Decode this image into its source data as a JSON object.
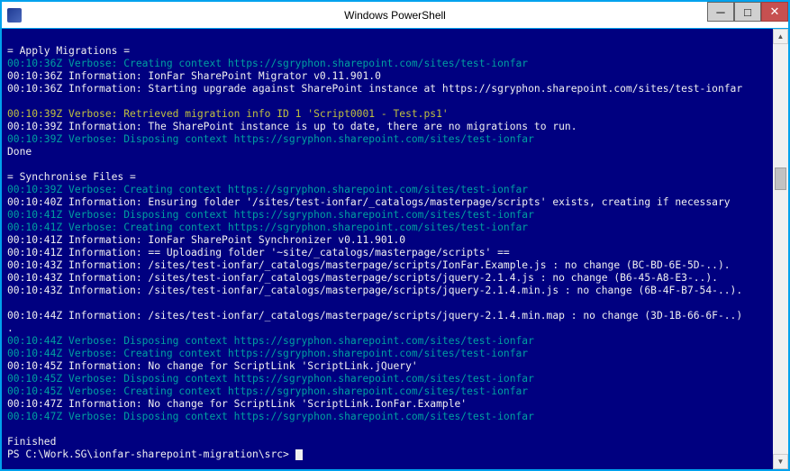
{
  "window": {
    "title": "Windows PowerShell"
  },
  "buttons": {
    "min": "─",
    "max": "□",
    "close": "✕"
  },
  "scrollbar": {
    "up": "▲",
    "down": "▼"
  },
  "colors": {
    "bg": "#000080",
    "accent": "#00a2ed",
    "cyan": "#00a0a0",
    "yellow": "#c0c040",
    "white": "#f0f0f0"
  },
  "prompt": "PS C:\\Work.SG\\ionfar-sharepoint-migration\\src> ",
  "lines": [
    {
      "c": "white",
      "t": ""
    },
    {
      "c": "white",
      "t": "= Apply Migrations ="
    },
    {
      "c": "cyan",
      "t": "00:10:36Z Verbose: Creating context https://sgryphon.sharepoint.com/sites/test-ionfar"
    },
    {
      "c": "white",
      "t": "00:10:36Z Information: IonFar SharePoint Migrator v0.11.901.0"
    },
    {
      "c": "white",
      "t": "00:10:36Z Information: Starting upgrade against SharePoint instance at https://sgryphon.sharepoint.com/sites/test-ionfar"
    },
    {
      "c": "white",
      "t": ""
    },
    {
      "c": "yellow",
      "t": "00:10:39Z Verbose: Retrieved migration info ID 1 'Script0001 - Test.ps1'"
    },
    {
      "c": "white",
      "t": "00:10:39Z Information: The SharePoint instance is up to date, there are no migrations to run."
    },
    {
      "c": "cyan",
      "t": "00:10:39Z Verbose: Disposing context https://sgryphon.sharepoint.com/sites/test-ionfar"
    },
    {
      "c": "white",
      "t": "Done"
    },
    {
      "c": "white",
      "t": ""
    },
    {
      "c": "white",
      "t": "= Synchronise Files ="
    },
    {
      "c": "cyan",
      "t": "00:10:39Z Verbose: Creating context https://sgryphon.sharepoint.com/sites/test-ionfar"
    },
    {
      "c": "white",
      "t": "00:10:40Z Information: Ensuring folder '/sites/test-ionfar/_catalogs/masterpage/scripts' exists, creating if necessary"
    },
    {
      "c": "cyan",
      "t": "00:10:41Z Verbose: Disposing context https://sgryphon.sharepoint.com/sites/test-ionfar"
    },
    {
      "c": "cyan",
      "t": "00:10:41Z Verbose: Creating context https://sgryphon.sharepoint.com/sites/test-ionfar"
    },
    {
      "c": "white",
      "t": "00:10:41Z Information: IonFar SharePoint Synchronizer v0.11.901.0"
    },
    {
      "c": "white",
      "t": "00:10:41Z Information: == Uploading folder '~site/_catalogs/masterpage/scripts' =="
    },
    {
      "c": "white",
      "t": "00:10:43Z Information: /sites/test-ionfar/_catalogs/masterpage/scripts/IonFar.Example.js : no change (BC-BD-6E-5D-..)."
    },
    {
      "c": "white",
      "t": "00:10:43Z Information: /sites/test-ionfar/_catalogs/masterpage/scripts/jquery-2.1.4.js : no change (B6-45-A8-E3-..)."
    },
    {
      "c": "white",
      "t": "00:10:43Z Information: /sites/test-ionfar/_catalogs/masterpage/scripts/jquery-2.1.4.min.js : no change (6B-4F-B7-54-..)."
    },
    {
      "c": "white",
      "t": ""
    },
    {
      "c": "white",
      "t": "00:10:44Z Information: /sites/test-ionfar/_catalogs/masterpage/scripts/jquery-2.1.4.min.map : no change (3D-1B-66-6F-..)"
    },
    {
      "c": "white",
      "t": "."
    },
    {
      "c": "cyan",
      "t": "00:10:44Z Verbose: Disposing context https://sgryphon.sharepoint.com/sites/test-ionfar"
    },
    {
      "c": "cyan",
      "t": "00:10:44Z Verbose: Creating context https://sgryphon.sharepoint.com/sites/test-ionfar"
    },
    {
      "c": "white",
      "t": "00:10:45Z Information: No change for ScriptLink 'ScriptLink.jQuery'"
    },
    {
      "c": "cyan",
      "t": "00:10:45Z Verbose: Disposing context https://sgryphon.sharepoint.com/sites/test-ionfar"
    },
    {
      "c": "cyan",
      "t": "00:10:45Z Verbose: Creating context https://sgryphon.sharepoint.com/sites/test-ionfar"
    },
    {
      "c": "white",
      "t": "00:10:47Z Information: No change for ScriptLink 'ScriptLink.IonFar.Example'"
    },
    {
      "c": "cyan",
      "t": "00:10:47Z Verbose: Disposing context https://sgryphon.sharepoint.com/sites/test-ionfar"
    },
    {
      "c": "white",
      "t": ""
    },
    {
      "c": "white",
      "t": "Finished"
    }
  ]
}
